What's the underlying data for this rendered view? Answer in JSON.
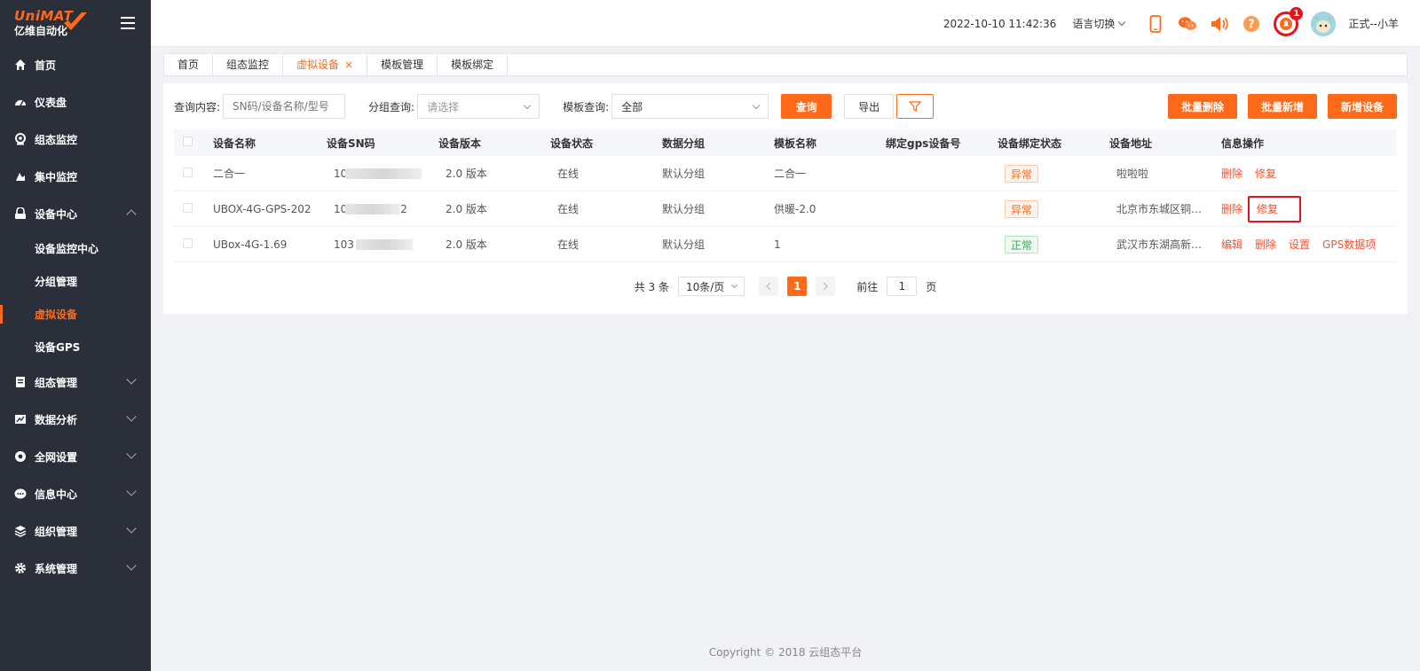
{
  "brand": {
    "line1": "UniMAT",
    "line2": "亿维自动化",
    "accent": "#ff6a1a"
  },
  "sidebar": {
    "items": [
      {
        "label": "首页",
        "icon": "home-icon"
      },
      {
        "label": "仪表盘",
        "icon": "dashboard-icon"
      },
      {
        "label": "组态监控",
        "icon": "monitor-icon"
      },
      {
        "label": "集中监控",
        "icon": "central-monitor-icon"
      },
      {
        "label": "设备中心",
        "icon": "device-center-icon",
        "expanded": true
      }
    ],
    "sub_items": [
      {
        "label": "设备监控中心"
      },
      {
        "label": "分组管理"
      },
      {
        "label": "虚拟设备",
        "active": true
      },
      {
        "label": "设备GPS"
      }
    ],
    "items_after": [
      {
        "label": "组态管理",
        "icon": "config-icon"
      },
      {
        "label": "数据分析",
        "icon": "analytics-icon"
      },
      {
        "label": "全网设置",
        "icon": "network-settings-icon"
      },
      {
        "label": "信息中心",
        "icon": "message-icon"
      },
      {
        "label": "组织管理",
        "icon": "organization-icon"
      },
      {
        "label": "系统管理",
        "icon": "system-icon"
      }
    ]
  },
  "header": {
    "datetime": "2022-10-10 11:42:36",
    "language": "语言切换",
    "notification_count": "1",
    "username": "正式--小羊"
  },
  "tabs": [
    {
      "label": "首页"
    },
    {
      "label": "组态监控"
    },
    {
      "label": "虚拟设备",
      "active": true,
      "close": "×"
    },
    {
      "label": "模板管理"
    },
    {
      "label": "模板绑定"
    }
  ],
  "filters": {
    "query_label": "查询内容:",
    "query_placeholder": "SN码/设备名称/型号",
    "group_label": "分组查询:",
    "group_placeholder": "请选择",
    "template_label": "模板查询:",
    "template_value": "全部",
    "search_button": "查询",
    "export_button": "导出",
    "batch_delete": "批量删除",
    "batch_add": "批量新增",
    "add_device": "新增设备"
  },
  "table": {
    "columns": [
      "设备名称",
      "设备SN码",
      "设备版本",
      "设备状态",
      "数据分组",
      "模板名称",
      "绑定gps设备号",
      "设备绑定状态",
      "设备地址",
      "信息操作"
    ],
    "rows": [
      {
        "name": "二合一",
        "sn_prefix": "10",
        "sn_suffix": "",
        "version": "2.0 版本",
        "status": "在线",
        "group": "默认分组",
        "template": "二合一",
        "gps": "",
        "bind_status": "异常",
        "bind_ok": false,
        "address": "啦啦啦",
        "ops": [
          "删除",
          "修复"
        ]
      },
      {
        "name": "UBOX-4G-GPS-202",
        "sn_prefix": "10",
        "sn_suffix": "2",
        "version": "2.0 版本",
        "status": "在线",
        "group": "默认分组",
        "template": "供暖-2.0",
        "gps": "",
        "bind_status": "异常",
        "bind_ok": false,
        "address": "北京市东城区铜…",
        "ops": [
          "删除",
          "修复"
        ]
      },
      {
        "name": "UBox-4G-1.69",
        "sn_prefix": "103",
        "sn_suffix": "",
        "version": "2.0 版本",
        "status": "在线",
        "group": "默认分组",
        "template": "1",
        "gps": "",
        "bind_status": "正常",
        "bind_ok": true,
        "address": "武汉市东湖高新…",
        "ops": [
          "编辑",
          "删除",
          "设置",
          "GPS数据项"
        ]
      }
    ]
  },
  "pagination": {
    "total": "共 3 条",
    "page_size": "10条/页",
    "current": "1",
    "goto_label": "前往",
    "goto_value": "1",
    "page_suffix": "页"
  },
  "footer": {
    "copyright": "Copyright © 2018 云组态平台"
  }
}
